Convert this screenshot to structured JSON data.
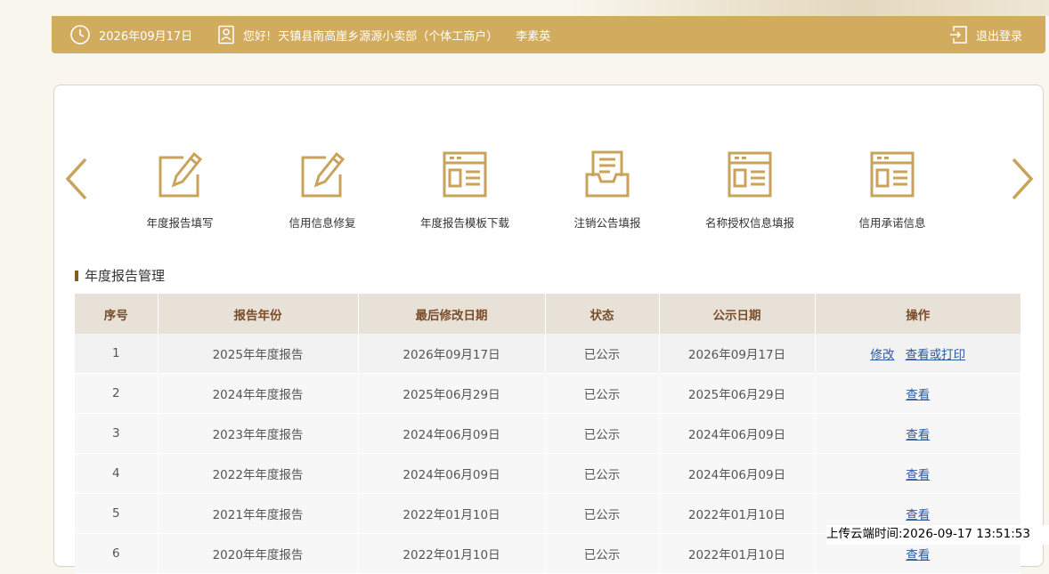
{
  "header": {
    "date": "2026年09月17日",
    "greeting": "您好!",
    "company": "天镇县南高崖乡源源小卖部（个体工商户）",
    "user": "李素英",
    "logout": "退出登录"
  },
  "nav": {
    "items": [
      {
        "label": "年度报告填写",
        "icon": "edit-form-icon"
      },
      {
        "label": "信用信息修复",
        "icon": "edit-form-icon"
      },
      {
        "label": "年度报告模板下载",
        "icon": "document-window-icon"
      },
      {
        "label": "注销公告填报",
        "icon": "inbox-tray-icon"
      },
      {
        "label": "名称授权信息填报",
        "icon": "document-window-icon"
      },
      {
        "label": "信用承诺信息",
        "icon": "document-window-icon"
      }
    ]
  },
  "section": {
    "title": "年度报告管理"
  },
  "table": {
    "headers": [
      "序号",
      "报告年份",
      "最后修改日期",
      "状态",
      "公示日期",
      "操作"
    ],
    "rows": [
      {
        "no": "1",
        "year": "2025年年度报告",
        "modified": "2026年09月17日",
        "status": "已公示",
        "published": "2026年09月17日",
        "ops": [
          "修改",
          "查看或打印"
        ]
      },
      {
        "no": "2",
        "year": "2024年年度报告",
        "modified": "2025年06月29日",
        "status": "已公示",
        "published": "2025年06月29日",
        "ops": [
          "查看"
        ]
      },
      {
        "no": "3",
        "year": "2023年年度报告",
        "modified": "2024年06月09日",
        "status": "已公示",
        "published": "2024年06月09日",
        "ops": [
          "查看"
        ]
      },
      {
        "no": "4",
        "year": "2022年年度报告",
        "modified": "2024年06月09日",
        "status": "已公示",
        "published": "2024年06月09日",
        "ops": [
          "查看"
        ]
      },
      {
        "no": "5",
        "year": "2021年年度报告",
        "modified": "2022年01月10日",
        "status": "已公示",
        "published": "2022年01月10日",
        "ops": [
          "查看"
        ]
      },
      {
        "no": "6",
        "year": "2020年年度报告",
        "modified": "2022年01月10日",
        "status": "已公示",
        "published": "2022年01月10日",
        "ops": [
          "查看"
        ]
      }
    ]
  },
  "overlay": {
    "upload_time": "上传云端时间:2026-09-17 13:51:53"
  },
  "colors": {
    "accent": "#d1ab5e",
    "icon": "#c9a35a",
    "header_text": "#7a4d2a",
    "link": "#2e5a9e"
  }
}
